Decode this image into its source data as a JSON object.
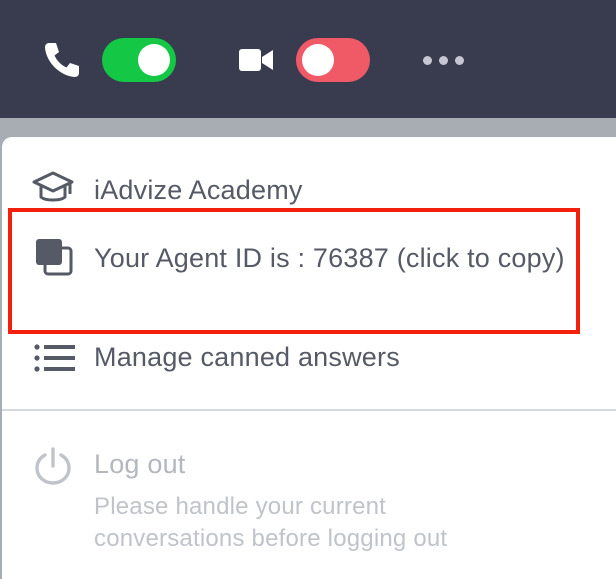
{
  "topbar": {
    "phone_icon": "phone-icon",
    "phone_toggle": {
      "state": "on",
      "color": "#14c745"
    },
    "video_icon": "video-camera-icon",
    "video_toggle": {
      "state": "off",
      "color": "#f05a66"
    },
    "more_icon": "more-horizontal-icon"
  },
  "menu": {
    "items": [
      {
        "icon": "graduation-cap-icon",
        "label": "iAdvize Academy"
      },
      {
        "icon": "copy-icon",
        "label": "Your Agent ID is : 76387 (click to copy)"
      },
      {
        "icon": "list-icon",
        "label": "Manage canned answers"
      }
    ],
    "logout": {
      "icon": "power-icon",
      "label": "Log out",
      "sublabel": "Please handle your current conversations before logging out"
    }
  },
  "colors": {
    "topbar_bg": "#383c4e",
    "highlight": "#f2200c",
    "text": "#555a66",
    "disabled_text": "#b4b7be"
  }
}
